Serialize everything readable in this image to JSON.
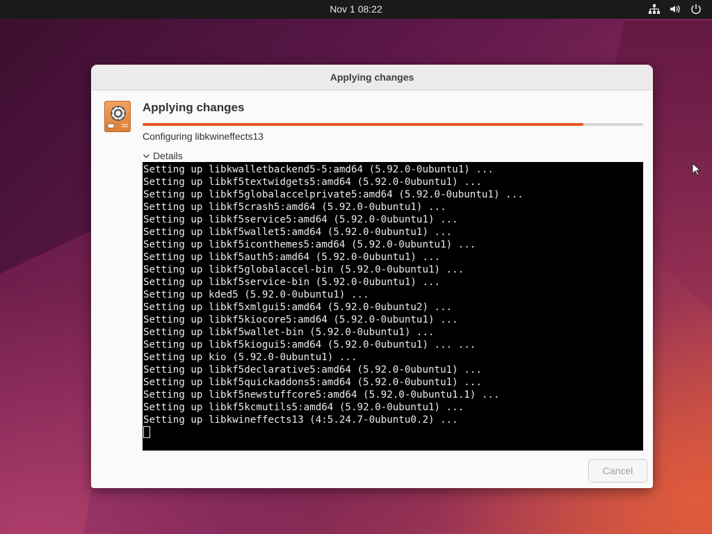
{
  "topbar": {
    "clock": "Nov 1  08:22",
    "tray_icons": [
      "network-icon",
      "volume-icon",
      "power-icon"
    ]
  },
  "dialog": {
    "window_title": "Applying changes",
    "heading": "Applying changes",
    "progress_fraction": 0.88,
    "progress_color": "#e95420",
    "status": "Configuring libkwineffects13",
    "details_label": "Details",
    "terminal_lines": [
      "Setting up libkwalletbackend5-5:amd64 (5.92.0-0ubuntu1) ...",
      "Setting up libkf5textwidgets5:amd64 (5.92.0-0ubuntu1) ...",
      "Setting up libkf5globalaccelprivate5:amd64 (5.92.0-0ubuntu1) ...",
      "Setting up libkf5crash5:amd64 (5.92.0-0ubuntu1) ...",
      "Setting up libkf5service5:amd64 (5.92.0-0ubuntu1) ...",
      "Setting up libkf5wallet5:amd64 (5.92.0-0ubuntu1) ...",
      "Setting up libkf5iconthemes5:amd64 (5.92.0-0ubuntu1) ...",
      "Setting up libkf5auth5:amd64 (5.92.0-0ubuntu1) ...",
      "Setting up libkf5globalaccel-bin (5.92.0-0ubuntu1) ...",
      "Setting up libkf5service-bin (5.92.0-0ubuntu1) ...",
      "Setting up kded5 (5.92.0-0ubuntu1) ...",
      "Setting up libkf5xmlgui5:amd64 (5.92.0-0ubuntu2) ...",
      "Setting up libkf5kiocore5:amd64 (5.92.0-0ubuntu1) ...",
      "Setting up libkf5wallet-bin (5.92.0-0ubuntu1) ...",
      "Setting up libkf5kiogui5:amd64 (5.92.0-0ubuntu1) ... ...",
      "Setting up kio (5.92.0-0ubuntu1) ...",
      "Setting up libkf5declarative5:amd64 (5.92.0-0ubuntu1) ...",
      "Setting up libkf5quickaddons5:amd64 (5.92.0-0ubuntu1) ...",
      "Setting up libkf5newstuffcore5:amd64 (5.92.0-0ubuntu1.1) ...",
      "Setting up libkf5kcmutils5:amd64 (5.92.0-0ubuntu1) ...",
      "Setting up libkwineffects13 (4:5.24.7-0ubuntu0.2) ..."
    ],
    "cancel_label": "Cancel"
  }
}
